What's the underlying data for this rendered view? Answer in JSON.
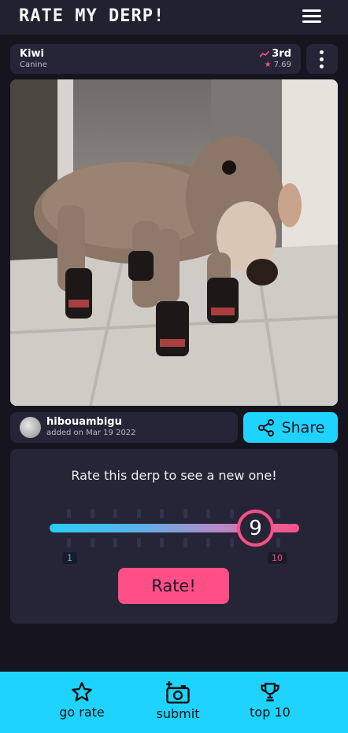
{
  "app": {
    "title": "RATE MY DERP!"
  },
  "pet": {
    "name": "Kiwi",
    "species": "Canine",
    "rank": "3rd",
    "score": "7.69"
  },
  "photo": {
    "description": ""
  },
  "submitter": {
    "username": "hibouambigu",
    "added": "added on Mar 19 2022"
  },
  "share": {
    "label": "Share"
  },
  "rating": {
    "prompt": "Rate this derp to see a new one!",
    "value": "9",
    "min_label": "1",
    "max_label": "10",
    "button_label": "Rate!"
  },
  "nav": {
    "items": [
      {
        "label": "go rate",
        "icon": "star-icon"
      },
      {
        "label": "submit",
        "icon": "camera-add-icon"
      },
      {
        "label": "top 10",
        "icon": "trophy-icon"
      }
    ]
  },
  "colors": {
    "accent_cyan": "#1fd3ff",
    "accent_pink": "#ff4f86",
    "background": "#15141f",
    "card": "#262537"
  }
}
